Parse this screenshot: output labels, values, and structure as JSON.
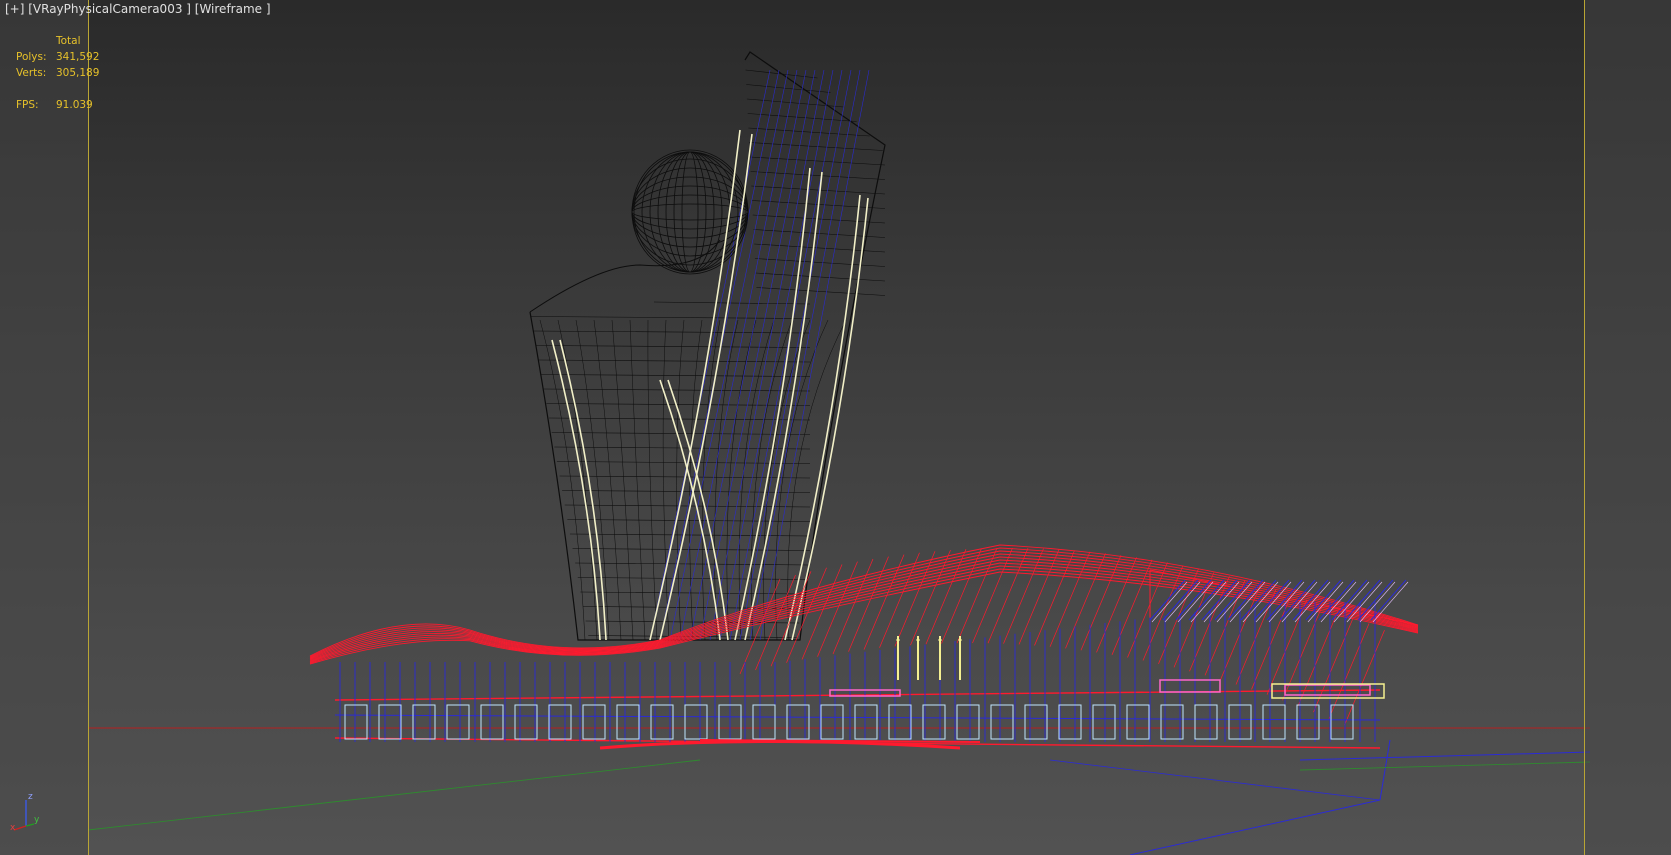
{
  "viewport": {
    "label": "[+] [VRayPhysicalCamera003 ] [Wireframe ]",
    "frame_color": "#b9a534"
  },
  "stats": {
    "header": "Total",
    "polys_label": "Polys:",
    "polys_value": "341,592",
    "verts_label": "Verts:",
    "verts_value": "305,189",
    "fps_label": "FPS:",
    "fps_value": "91.039",
    "color": "#e6c12a"
  },
  "axis_gizmo": {
    "z_label": "z",
    "x_label": "x",
    "y_label": "y"
  },
  "wireframe_colors": {
    "tower": "#0d0d0d",
    "tower_fins": "#f2f0c8",
    "tower_blue": "#2a2ad0",
    "roof": "#ff1a2e",
    "structure_blue": "#2b2bd6",
    "glass": "#bfe6ff",
    "pink": "#ff66cc",
    "yellow": "#f5f090"
  }
}
